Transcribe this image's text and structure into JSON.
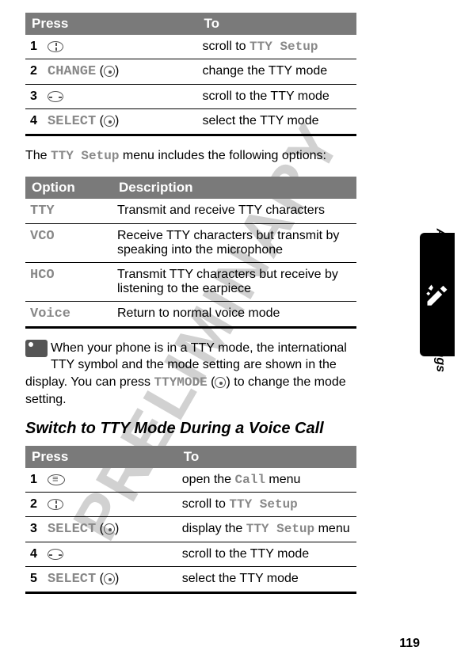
{
  "headers": {
    "press": "Press",
    "to": "To",
    "option": "Option",
    "description": "Description"
  },
  "table1": {
    "rows": [
      {
        "num": "1",
        "btn_type": "nav-ud",
        "to": "scroll to ",
        "to_mono": "TTY Setup"
      },
      {
        "num": "2",
        "btn_label": "CHANGE",
        "soft": true,
        "to": "change the TTY mode"
      },
      {
        "num": "3",
        "btn_type": "nav-lr",
        "to": "scroll to the TTY mode"
      },
      {
        "num": "4",
        "btn_label": "SELECT",
        "soft": true,
        "to": "select the TTY mode"
      }
    ]
  },
  "intro_para": {
    "pre": "The ",
    "mono": "TTY Setup",
    "post": " menu includes the following options:"
  },
  "table2": {
    "rows": [
      {
        "opt": "TTY",
        "desc": "Transmit and receive TTY characters"
      },
      {
        "opt": "VCO",
        "desc": "Receive TTY characters but transmit by speaking into the microphone"
      },
      {
        "opt": "HCO",
        "desc": "Transmit TTY characters but receive by listening to the earpiece"
      },
      {
        "opt": "Voice",
        "desc": "Return to normal voice mode"
      }
    ]
  },
  "note_para": {
    "line1": "When your phone is in a TTY mode, the international TTY symbol and the mode setting are shown in the display. You can press ",
    "mono": "TTYMODE",
    "line2": " (",
    "line3": ") to change the mode setting."
  },
  "section_heading": "Switch to TTY Mode During a Voice Call",
  "table3": {
    "rows": [
      {
        "num": "1",
        "btn_type": "menu",
        "to": "open the ",
        "to_mono": "Call",
        "to_post": " menu"
      },
      {
        "num": "2",
        "btn_type": "nav-ud",
        "to": "scroll to ",
        "to_mono": "TTY Setup"
      },
      {
        "num": "3",
        "btn_label": "SELECT",
        "soft": true,
        "to": "display the ",
        "to_mono": "TTY Setup",
        "to_post": " menu"
      },
      {
        "num": "4",
        "btn_type": "nav-lr",
        "to": "scroll to the TTY mode"
      },
      {
        "num": "5",
        "btn_label": "SELECT",
        "soft": true,
        "to": "select the TTY mode"
      }
    ]
  },
  "side_label": "Adjusting Your Settings",
  "page_number": "119"
}
